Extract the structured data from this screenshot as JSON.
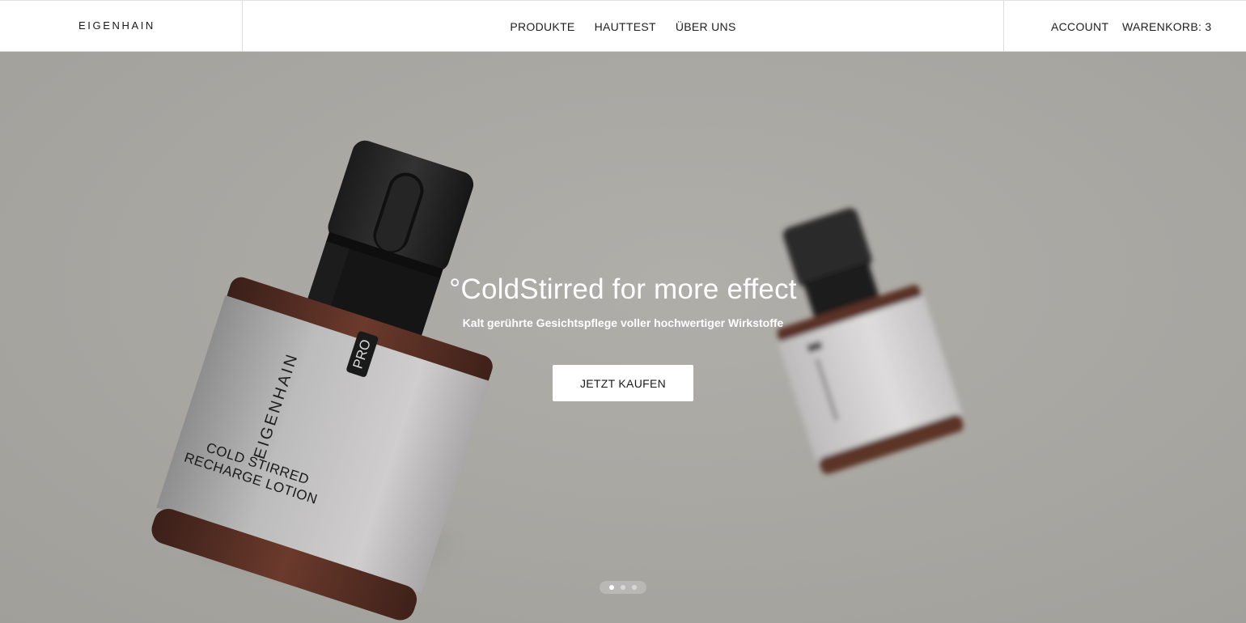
{
  "brand": {
    "logo_text": "EIGENHAIN"
  },
  "nav": {
    "items": [
      {
        "label": "PRODUKTE"
      },
      {
        "label": "HAUTTEST"
      },
      {
        "label": "ÜBER UNS"
      }
    ],
    "account_label": "ACCOUNT",
    "cart_label": "WARENKORB: 3"
  },
  "hero": {
    "title": "°ColdStirred for more effect",
    "subtitle": "Kalt gerührte Gesichtspflege voller hochwertiger Wirkstoffe",
    "cta_label": "JETZT KAUFEN",
    "slides_total": 3,
    "active_slide": 1,
    "product_label": {
      "badge": "PRO",
      "brand": "EIGENHAIN",
      "line1": "COLD STIRRED",
      "line2": "RECHARGE LOTION"
    }
  },
  "colors": {
    "hero_background": "#a8a6a1",
    "text_dark": "#1a1a1a",
    "white": "#ffffff"
  }
}
